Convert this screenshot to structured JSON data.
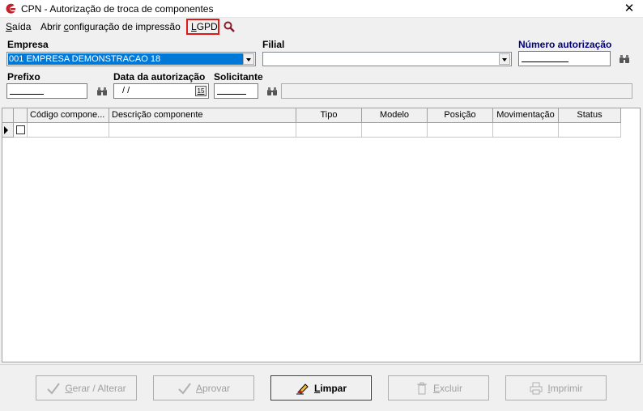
{
  "window": {
    "title": "CPN - Autorização de troca de componentes",
    "close_glyph": "✕"
  },
  "menu": {
    "items": [
      {
        "first": "S",
        "rest": "aída"
      },
      {
        "first": "Abrir ",
        "rest": "configuração de impressão",
        "ul": "c"
      },
      {
        "first": "L",
        "rest": "GPD"
      }
    ],
    "exit_first": "S",
    "exit_rest": "aída",
    "print_pre": "Abrir ",
    "print_ul": "c",
    "print_rest": "onfiguração de impressão",
    "lgpd_ul": "L",
    "lgpd_rest": "GPD",
    "highlight_color": "#e01818",
    "search_icon": "magnifier-icon"
  },
  "form": {
    "empresa_label": "Empresa",
    "empresa_value": "001 EMPRESA DEMONSTRACAO 18",
    "filial_label": "Filial",
    "filial_value": "",
    "numero_label": "Número autorização",
    "prefixo_label": "Prefixo",
    "data_label": "Data da autorização",
    "data_value": "/ /",
    "calendar_label": "15",
    "solicitante_label": "Solicitante",
    "solicitante_name_value": ""
  },
  "grid": {
    "columns": [
      "Código compone...",
      "Descrição componente",
      "Tipo",
      "Modelo",
      "Posição",
      "Movimentação",
      "Status"
    ]
  },
  "buttons": {
    "gerar": {
      "ul": "G",
      "rest": "erar / Alterar"
    },
    "aprovar": {
      "ul": "A",
      "rest": "provar"
    },
    "limpar": {
      "ul": "L",
      "rest": "impar"
    },
    "excluir": {
      "ul": "E",
      "rest": "xcluir"
    },
    "imprimir": {
      "ul": "I",
      "rest": "mprimir"
    }
  },
  "colors": {
    "selection": "#0078d7",
    "label_blue": "#000080",
    "disabled_text": "#a0a0a0"
  }
}
